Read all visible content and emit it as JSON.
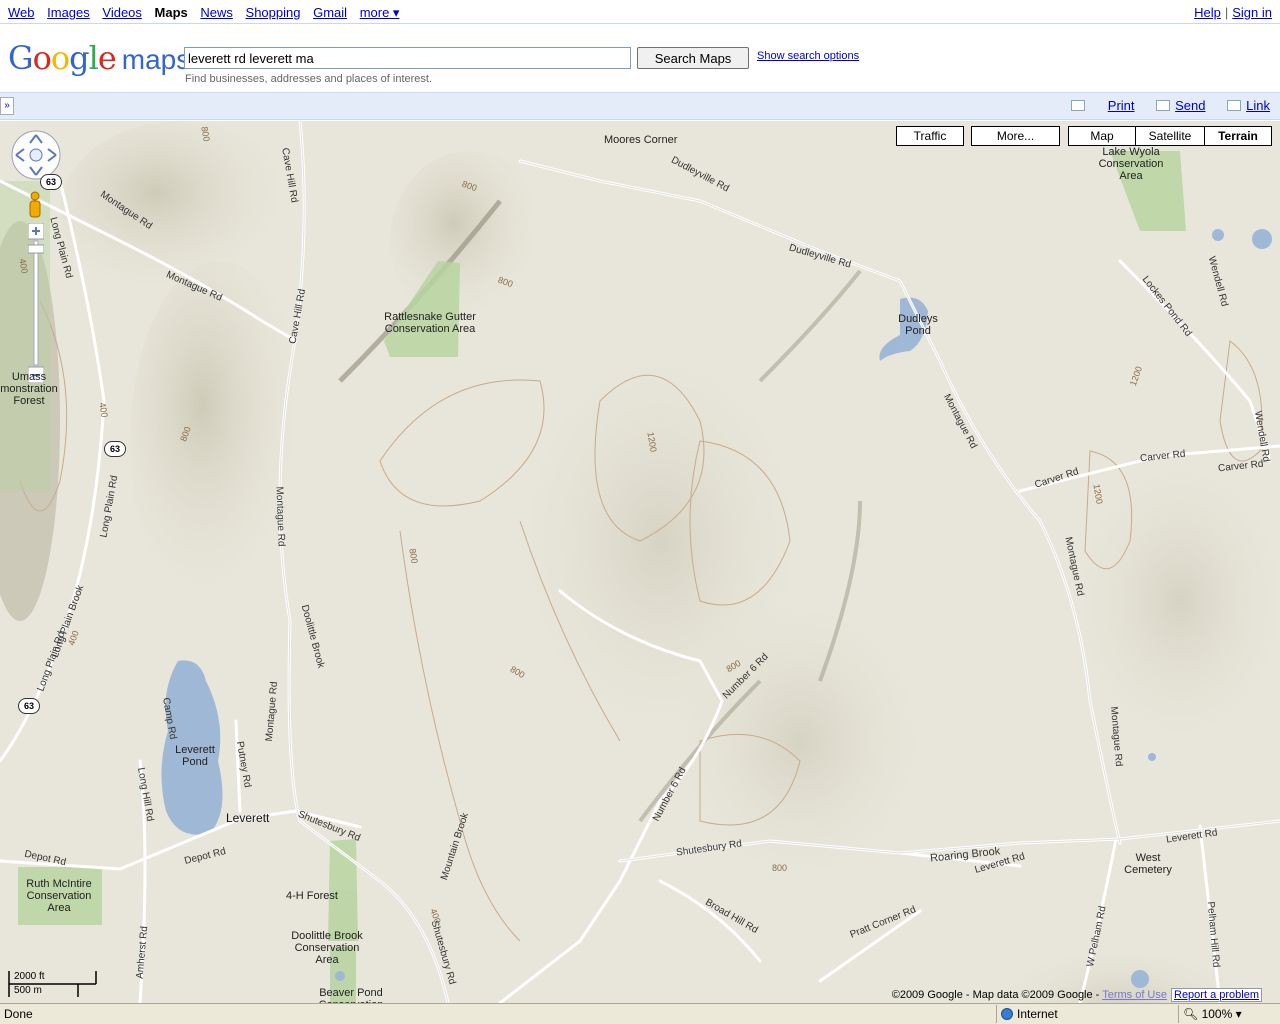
{
  "topnav": {
    "items": [
      "Web",
      "Images",
      "Videos",
      "Maps",
      "News",
      "Shopping",
      "Gmail",
      "more ▾"
    ],
    "active": "Maps",
    "help": "Help",
    "signin": "Sign in"
  },
  "header": {
    "logo_google": "Google",
    "logo_maps": "maps",
    "search_value": "leverett rd leverett ma",
    "search_button": "Search Maps",
    "search_options": "Show search options",
    "hint": "Find businesses, addresses and places of interest."
  },
  "toolbar": {
    "collapse": "»",
    "print": "Print",
    "send": "Send",
    "link": "Link"
  },
  "map": {
    "buttons": {
      "traffic": "Traffic",
      "more": "More...",
      "map": "Map",
      "satellite": "Satellite",
      "terrain": "Terrain",
      "active": "Terrain"
    },
    "colors": {
      "terrain_base": "#e8e6da",
      "park": "#b7d3a0",
      "water": "#9fb8d6",
      "road": "#ffffff",
      "contour": "#c9a98b"
    },
    "places": {
      "moores_corner": "Moores Corner",
      "lake_wyola": "Lake Wyola Conservation Area",
      "rattlesnake": "Rattlesnake Gutter Conservation Area",
      "dudleys_pond": "Dudleys Pond",
      "umass_forest": "Umass monstration Forest",
      "leverett_pond": "Leverett Pond",
      "leverett": "Leverett",
      "west_cemetery": "West Cemetery",
      "ruth_mcintire": "Ruth McIntire Conservation Area",
      "four_h_forest": "4-H Forest",
      "doolittle_brook_ca": "Doolittle Brook Conservation Area",
      "beaver_pond": "Beaver Pond Conservation"
    },
    "roads": {
      "cave_hill_rd": "Cave Hill Rd",
      "dudleyville_rd": "Dudleyville Rd",
      "montague_rd": "Montague Rd",
      "long_plain_rd": "Long Plain Rd",
      "long_plain_brook": "Long Plain Brook",
      "lockes_pond_rd": "Lockes Pond Rd",
      "wendell_rd": "Wendell Rd",
      "carver_rd": "Carver Rd",
      "doolittle_brook": "Doolittle Brook",
      "number_6_rd": "Number 6 Rd",
      "camp_rd": "Camp Rd",
      "putney_rd": "Putney Rd",
      "long_hill_rd": "Long Hill Rd",
      "shutesbury_rd": "Shutesbury Rd",
      "depot_rd": "Depot Rd",
      "mountain_brook": "Mountain Brook",
      "roaring_brook": "Roaring Brook",
      "leverett_rd": "Leverett Rd",
      "broad_hill_rd": "Broad Hill Rd",
      "pratt_corner_rd": "Pratt Corner Rd",
      "amherst_rd": "Amherst Rd",
      "w_pelham_rd": "W Pelham Rd",
      "pelham_hill_rd": "Pelham Hill Rd"
    },
    "routes": [
      "63",
      "63",
      "63"
    ],
    "contours": [
      "800",
      "800",
      "400",
      "800",
      "400",
      "800",
      "400",
      "800",
      "1200",
      "800",
      "800",
      "800",
      "1200",
      "1200",
      "400",
      "400"
    ],
    "scale": {
      "imperial": "2000 ft",
      "metric": "500 m"
    },
    "copyright": "©2009 Google - Map data ©2009 Google - ",
    "terms": "Terms of Use",
    "report": "Report a problem"
  },
  "statusbar": {
    "done": "Done",
    "zone": "Internet",
    "zoom": "100%"
  }
}
